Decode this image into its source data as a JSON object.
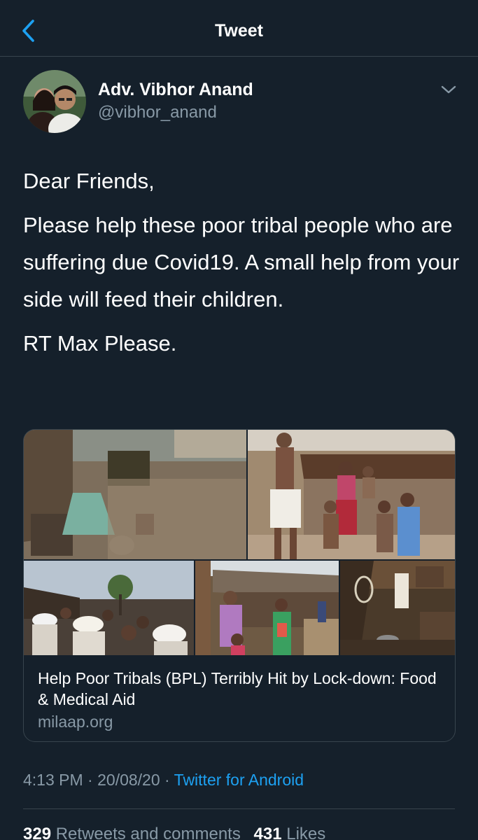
{
  "nav": {
    "title": "Tweet"
  },
  "author": {
    "name": "Adv. Vibhor Anand",
    "handle": "@vibhor_anand"
  },
  "tweet": {
    "paragraphs": [
      "Dear Friends,",
      "Please help these poor tribal people who are suffering due Covid19. A small help from your side will feed their children.",
      "RT Max Please."
    ],
    "time": "4:13 PM",
    "separator": " · ",
    "date": "20/08/20",
    "source": "Twitter for Android"
  },
  "card": {
    "title": "Help Poor Tribals (BPL) Terribly Hit by Lock-down: Food & Medical Aid",
    "domain": "milaap.org"
  },
  "stats": {
    "retweets_count": "329",
    "retweets_label": "Retweets and comments",
    "likes_count": "431",
    "likes_label": "Likes"
  },
  "colors": {
    "background": "#15202b",
    "accent": "#1da1f2",
    "secondary_text": "#8899a6",
    "border": "#38444d"
  },
  "icons": {
    "back": "chevron-left-icon",
    "menu": "chevron-down-icon"
  }
}
